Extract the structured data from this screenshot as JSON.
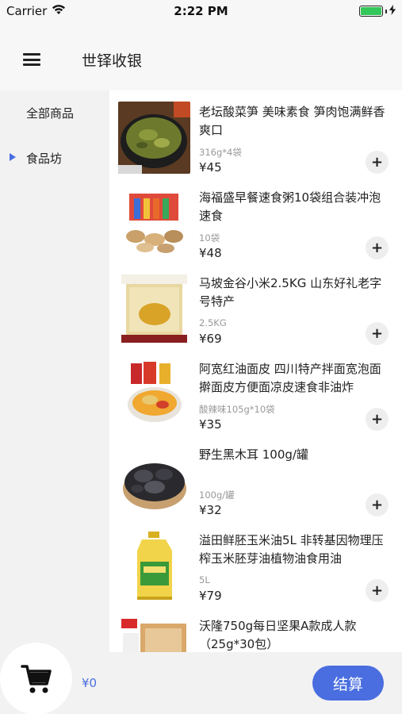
{
  "status_bar": {
    "carrier": "Carrier",
    "time": "2:22 PM"
  },
  "header": {
    "title": "世铎收银"
  },
  "sidebar": {
    "items": [
      {
        "label": "全部商品",
        "selected": false
      },
      {
        "label": "食品坊",
        "selected": true
      }
    ]
  },
  "products": [
    {
      "name": "老坛酸菜笋 美味素食 笋肉饱满鲜香爽口",
      "spec": "316g*4袋",
      "price": "¥45"
    },
    {
      "name": " 海福盛早餐速食粥10袋组合装冲泡速食",
      "spec": "10袋",
      "price": "¥48"
    },
    {
      "name": "马坡金谷小米2.5KG 山东好礼老字号特产",
      "spec": "2.5KG",
      "price": "¥69"
    },
    {
      "name": "阿宽红油面皮 四川特产拌面宽泡面擀面皮方便面凉皮速食非油炸",
      "spec": "酸辣味105g*10袋",
      "price": "¥35"
    },
    {
      "name": "野生黑木耳 100g/罐",
      "spec": "100g/罐",
      "price": "¥32"
    },
    {
      "name": "溢田鲜胚玉米油5L 非转基因物理压榨玉米胚芽油植物油食用油",
      "spec": "5L",
      "price": "¥79"
    },
    {
      "name": "沃隆750g每日坚果A款成人款（25g*30包）",
      "spec": "",
      "price": ""
    }
  ],
  "add_button_label": "+",
  "cart": {
    "total": "¥0",
    "checkout_label": "结算"
  },
  "colors": {
    "accent": "#4a6ee0",
    "price_text": "#222222"
  },
  "icons": {
    "menu": "hamburger-menu-icon",
    "cart": "shopping-cart-icon",
    "wifi": "wifi-icon",
    "battery": "battery-icon"
  }
}
